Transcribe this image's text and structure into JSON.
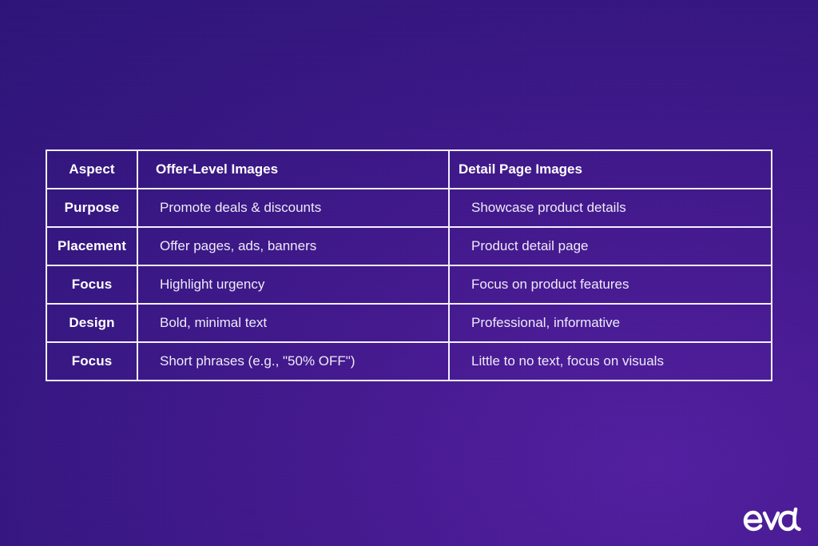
{
  "table": {
    "headers": {
      "aspect": "Aspect",
      "offer_level": "Offer-Level Images",
      "detail_page": "Detail Page Images"
    },
    "rows": [
      {
        "aspect": "Purpose",
        "offer_level": "Promote deals & discounts",
        "detail_page": "Showcase product details"
      },
      {
        "aspect": "Placement",
        "offer_level": "Offer pages, ads, banners",
        "detail_page": "Product detail page"
      },
      {
        "aspect": "Focus",
        "offer_level": "Highlight urgency",
        "detail_page": "Focus on product features"
      },
      {
        "aspect": "Design",
        "offer_level": "Bold, minimal text",
        "detail_page": "Professional, informative"
      },
      {
        "aspect": "Focus",
        "offer_level": "Short phrases (e.g., \"50% OFF\")",
        "detail_page": "Little to no text, focus on visuals"
      }
    ]
  },
  "brand": {
    "logo_text": "eva",
    "logo_icon": "eva-logo-icon"
  },
  "colors": {
    "background_dark": "#2d1478",
    "background_light": "#521fa0",
    "grid_line": "#f4f0fb",
    "text": "#ffffff"
  }
}
